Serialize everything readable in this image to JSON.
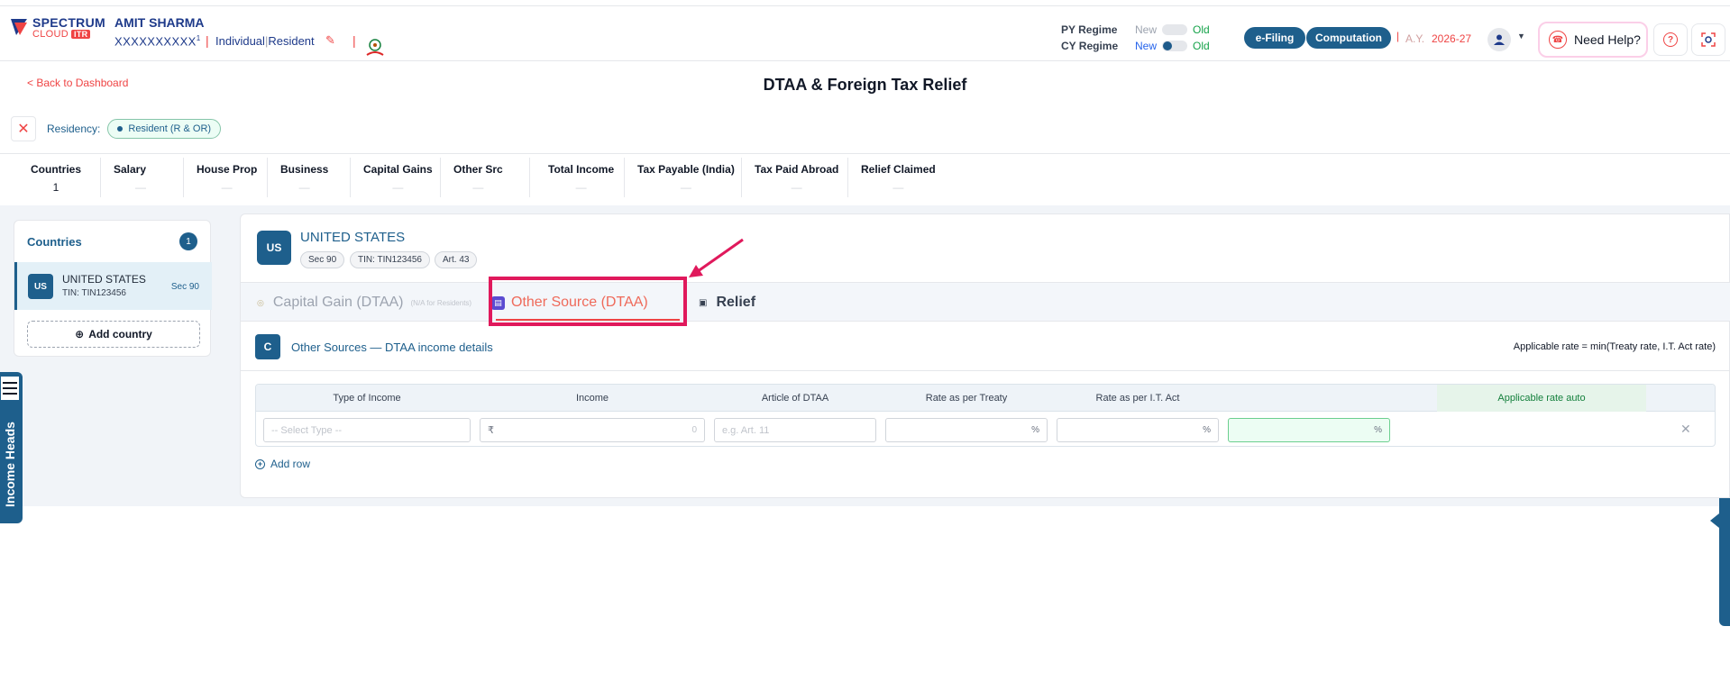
{
  "header": {
    "logo_line1": "SPECTRUM",
    "logo_line2": "CLOUD",
    "logo_badge": "ITR",
    "user_name": "AMIT SHARMA",
    "user_pan": "XXXXXXXXXX",
    "user_pan_sup": "1",
    "user_type": "Individual",
    "user_residency": "Resident",
    "py_regime_label": "PY Regime",
    "cy_regime_label": "CY Regime",
    "regime_new": "New",
    "regime_old": "Old",
    "efiling": "e-Filing",
    "computation": "Computation",
    "ay_label": "A.Y.",
    "ay_value": "2026-27",
    "need_help": "Need Help?"
  },
  "page": {
    "back_link": "< Back to Dashboard",
    "title": "DTAA & Foreign Tax Relief",
    "residency_label": "Residency:",
    "residency_value": "Resident (R & OR)"
  },
  "summary": [
    {
      "label": "Countries",
      "value": "1"
    },
    {
      "label": "Salary",
      "value": "—"
    },
    {
      "label": "House Prop",
      "value": "—"
    },
    {
      "label": "Business",
      "value": "—"
    },
    {
      "label": "Capital Gains",
      "value": "—"
    },
    {
      "label": "Other Src",
      "value": "—"
    },
    {
      "label": "Total Income",
      "value": "—"
    },
    {
      "label": "Tax Payable (India)",
      "value": "—"
    },
    {
      "label": "Tax Paid Abroad",
      "value": "—"
    },
    {
      "label": "Relief Claimed",
      "value": "—"
    }
  ],
  "countries_panel": {
    "title": "Countries",
    "count": "1",
    "items": [
      {
        "code": "US",
        "name": "UNITED STATES",
        "tin": "TIN: TIN123456",
        "sec": "Sec 90"
      }
    ],
    "add_label": "Add country"
  },
  "side_tab": {
    "label": "Income Heads"
  },
  "country_card": {
    "code": "US",
    "name": "UNITED STATES",
    "tags": [
      "Sec 90",
      "TIN: TIN123456",
      "Art. 43"
    ]
  },
  "tabs": {
    "capital_gain": "Capital Gain (DTAA)",
    "capital_gain_note": "(N/A for Residents)",
    "other_source": "Other Source (DTAA)",
    "relief": "Relief"
  },
  "section": {
    "badge": "C",
    "title": "Other Sources — DTAA income details",
    "rate_note": "Applicable rate = min(Treaty rate, I.T. Act rate)"
  },
  "table": {
    "columns": [
      "Type of Income",
      "Income",
      "Article of DTAA",
      "Rate as per Treaty",
      "Rate as per I.T. Act",
      "Applicable rate auto"
    ],
    "row": {
      "type_placeholder": "-- Select Type --",
      "income_prefix": "₹",
      "income_value": "0",
      "article_placeholder": "e.g. Art. 11",
      "percent": "%"
    },
    "add_row": "Add row"
  },
  "icons": {
    "close": "close-icon",
    "pencil": "pencil-icon",
    "user": "user-icon",
    "help": "help-icon",
    "scan": "scan-icon",
    "delete": "delete-icon"
  }
}
